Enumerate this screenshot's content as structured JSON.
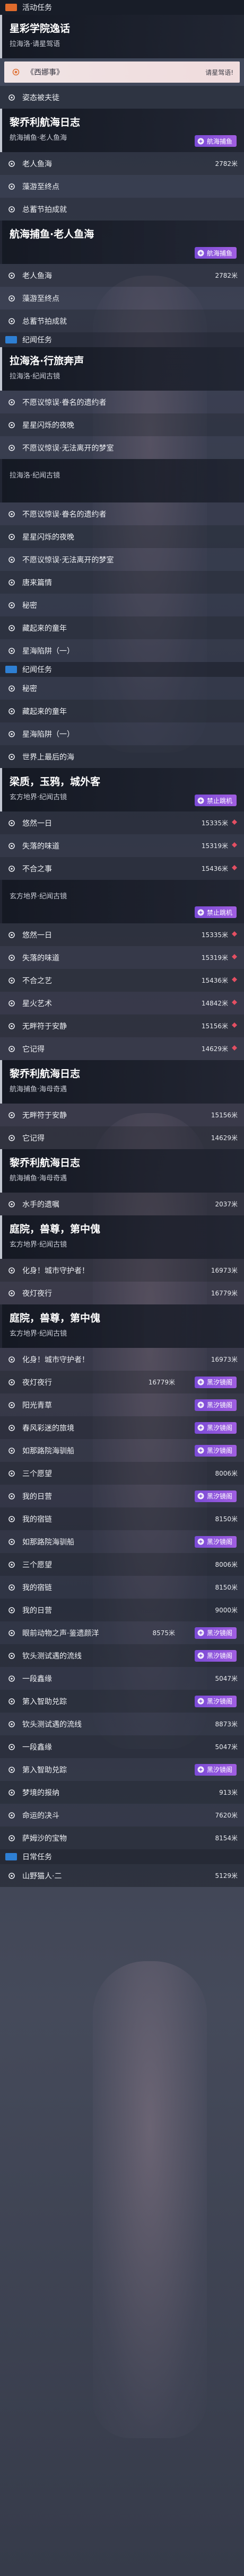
{
  "sections": [
    {
      "type": "cat",
      "active": true,
      "color": "#df6b2c",
      "label": "活动任务"
    },
    {
      "type": "q",
      "title": "星彩学院逸话",
      "sub": "拉海洛·请星驾语"
    },
    {
      "type": "hi",
      "label": "《西娜事》",
      "right": "请星驾语!"
    },
    {
      "type": "row",
      "label": "姿态被夫徒",
      "icon": "circle",
      "dist": "",
      "diamond": false
    },
    {
      "type": "q",
      "title": "黎乔利航海日志",
      "sub": "航海捕鱼·老人鱼海",
      "tag": "航海捕鱼"
    },
    {
      "type": "row",
      "label": "老人鱼海",
      "icon": "circle",
      "dist": "2782米",
      "diamond": false
    },
    {
      "type": "row",
      "label": "藻游至终点",
      "icon": "circle",
      "dist": "",
      "diamond": false
    },
    {
      "type": "row",
      "label": "总蓄节拍成就",
      "icon": "circle",
      "dist": "",
      "diamond": false
    },
    {
      "type": "q",
      "title": "航海捕鱼·老人鱼海",
      "sub": "",
      "tag": "航海捕鱼",
      "plain": true
    },
    {
      "type": "row",
      "label": "老人鱼海",
      "icon": "circle",
      "dist": "2782米",
      "diamond": false
    },
    {
      "type": "row",
      "label": "藻游至终点",
      "icon": "circle",
      "dist": "",
      "diamond": false
    },
    {
      "type": "row",
      "label": "总蓄节拍成就",
      "icon": "circle",
      "dist": "",
      "diamond": false
    },
    {
      "type": "cat",
      "active": false,
      "color": "#2e7fd3",
      "label": "纪闻任务"
    },
    {
      "type": "q",
      "title": "拉海洛·行旅奔声",
      "sub": "拉海洛·纪闻古镜"
    },
    {
      "type": "row",
      "label": "不愿议惊误·眷名的遗约者",
      "icon": "circle",
      "dist": "",
      "diamond": false
    },
    {
      "type": "row",
      "label": "星星闪烁的夜晚",
      "icon": "circle",
      "dist": "",
      "diamond": false
    },
    {
      "type": "row",
      "label": "不愿议惊误·无法离开的梦室",
      "icon": "circle",
      "dist": "",
      "diamond": false
    },
    {
      "type": "q",
      "title": "",
      "sub": "拉海洛·纪闻古镜",
      "plain": true
    },
    {
      "type": "row",
      "label": "不愿议惊误·眷名的遗约者",
      "icon": "circle",
      "dist": "",
      "diamond": false
    },
    {
      "type": "row",
      "label": "星星闪烁的夜晚",
      "icon": "circle",
      "dist": "",
      "diamond": false
    },
    {
      "type": "row",
      "label": "不愿议惊误·无法离开的梦室",
      "icon": "circle",
      "dist": "",
      "diamond": false
    },
    {
      "type": "row",
      "label": "唐来篇情",
      "icon": "circle",
      "dist": "",
      "diamond": false
    },
    {
      "type": "row",
      "label": "秘密",
      "icon": "circle",
      "dist": "",
      "diamond": false
    },
    {
      "type": "row",
      "label": "藏起来的童年",
      "icon": "circle",
      "dist": "",
      "diamond": false
    },
    {
      "type": "row",
      "label": "星海陷阱（一）",
      "icon": "circle",
      "dist": "",
      "diamond": false
    },
    {
      "type": "cat",
      "active": false,
      "color": "#2e7fd3",
      "label": "纪闻任务"
    },
    {
      "type": "row",
      "label": "秘密",
      "icon": "circle",
      "dist": "",
      "diamond": false
    },
    {
      "type": "row",
      "label": "藏起来的童年",
      "icon": "circle",
      "dist": "",
      "diamond": false
    },
    {
      "type": "row",
      "label": "星海陷阱（一）",
      "icon": "circle",
      "dist": "",
      "diamond": false
    },
    {
      "type": "row",
      "label": "世界上最后的海",
      "icon": "circle",
      "dist": "",
      "diamond": false
    },
    {
      "type": "q",
      "title": "梁质，玉鸦，城外客",
      "sub": "玄方地界·纪闻古镜",
      "tag": "禁止跳机"
    },
    {
      "type": "row",
      "label": "悠然一日",
      "icon": "circle",
      "dist": "15335米",
      "diamond": true
    },
    {
      "type": "row",
      "label": "失落的味道",
      "icon": "circle",
      "dist": "15319米",
      "diamond": true
    },
    {
      "type": "row",
      "label": "不合之事",
      "icon": "circle",
      "dist": "15436米",
      "diamond": true
    },
    {
      "type": "q",
      "title": "",
      "sub": "玄方地界·纪闻古镜",
      "tag": "禁止跳机",
      "plain": true
    },
    {
      "type": "row",
      "label": "悠然一日",
      "icon": "circle",
      "dist": "15335米",
      "diamond": true
    },
    {
      "type": "row",
      "label": "失落的味道",
      "icon": "circle",
      "dist": "15319米",
      "diamond": true
    },
    {
      "type": "row",
      "label": "不合之艺",
      "icon": "circle",
      "dist": "15436米",
      "diamond": true
    },
    {
      "type": "row",
      "label": "星火艺术",
      "icon": "circle",
      "dist": "14842米",
      "diamond": true
    },
    {
      "type": "row",
      "label": "无畔符于安静",
      "icon": "circle",
      "dist": "15156米",
      "diamond": true
    },
    {
      "type": "row",
      "label": "它记得",
      "icon": "circle",
      "dist": "14629米",
      "diamond": true
    },
    {
      "type": "q",
      "title": "黎乔利航海日志",
      "sub": "航海捕鱼·海母奇遇"
    },
    {
      "type": "row",
      "label": "无畔符于安静",
      "icon": "circle",
      "dist": "15156米",
      "diamond": false
    },
    {
      "type": "row",
      "label": "它记得",
      "icon": "circle",
      "dist": "14629米",
      "diamond": false
    },
    {
      "type": "q",
      "title": "黎乔利航海日志",
      "sub": "航海捕鱼·海母奇遇"
    },
    {
      "type": "row",
      "label": "水手的遗嘱",
      "icon": "circle",
      "dist": "2037米",
      "diamond": false
    },
    {
      "type": "q",
      "title": "庭院，兽尊，第中傀",
      "sub": "玄方地界·纪闻古镜"
    },
    {
      "type": "row",
      "label": "化身！城市守护者！",
      "icon": "circle",
      "dist": "16973米",
      "diamond": false
    },
    {
      "type": "row",
      "label": "夜灯夜行",
      "icon": "circle",
      "dist": "16779米",
      "diamond": false
    },
    {
      "type": "q",
      "title": "庭院，兽尊，第中傀",
      "sub": "玄方地界·纪闻古镜",
      "plain": true
    },
    {
      "type": "row",
      "label": "化身！城市守护者！",
      "icon": "circle",
      "dist": "16973米",
      "diamond": false
    },
    {
      "type": "row",
      "label": "夜灯夜行",
      "icon": "circle",
      "dist": "16779米",
      "diamond": false,
      "badge": "黑汐镜阁"
    },
    {
      "type": "row",
      "label": "阳光青草",
      "icon": "circle",
      "dist": "",
      "diamond": false,
      "badge": "黑汐镜阁"
    },
    {
      "type": "row",
      "label": "春风彩迷的旅境",
      "icon": "circle",
      "dist": "",
      "diamond": false,
      "badge": "黑汐镜阁"
    },
    {
      "type": "row",
      "label": "如那路院海驯船",
      "icon": "circle",
      "dist": "",
      "diamond": false,
      "badge": "黑汐镜阁"
    },
    {
      "type": "row",
      "label": "三个愿望",
      "icon": "circle",
      "dist": "8006米",
      "diamond": false
    },
    {
      "type": "row",
      "label": "我的日营",
      "icon": "circle",
      "dist": "",
      "diamond": false,
      "badge": "黑汐镜阁"
    },
    {
      "type": "row",
      "label": "我的宿链",
      "icon": "circle",
      "dist": "8150米",
      "diamond": false
    },
    {
      "type": "row",
      "label": "如那路院海驯船",
      "icon": "circle",
      "dist": "",
      "diamond": false,
      "badge": "黑汐镜阁"
    },
    {
      "type": "row",
      "label": "三个愿望",
      "icon": "circle",
      "dist": "8006米",
      "diamond": false
    },
    {
      "type": "row",
      "label": "我的宿链",
      "icon": "circle",
      "dist": "8150米",
      "diamond": false
    },
    {
      "type": "row",
      "label": "我的日营",
      "icon": "circle",
      "dist": "9000米",
      "diamond": false
    },
    {
      "type": "row",
      "label": "眼前动物之声·鉴遗颜洋",
      "icon": "circle",
      "dist": "8575米",
      "diamond": false,
      "badge": "黑汐镜阁"
    },
    {
      "type": "row",
      "label": "钦头测试遇的流线",
      "icon": "circle",
      "dist": "",
      "diamond": false,
      "badge": "黑汐镜阁"
    },
    {
      "type": "row",
      "label": "一段鑫缘",
      "icon": "circle",
      "dist": "5047米",
      "diamond": false
    },
    {
      "type": "row",
      "label": "第入智助兑踪",
      "icon": "circle",
      "dist": "",
      "diamond": false,
      "badge": "黑汐镜阁"
    },
    {
      "type": "row",
      "label": "钦头测试遇的流线",
      "icon": "circle",
      "dist": "8873米",
      "diamond": false
    },
    {
      "type": "row",
      "label": "一段鑫缘",
      "icon": "circle",
      "dist": "5047米",
      "diamond": false
    },
    {
      "type": "row",
      "label": "第入智助兑踪",
      "icon": "circle",
      "dist": "",
      "diamond": false,
      "badge": "黑汐镜阁"
    },
    {
      "type": "row",
      "label": "梦境的报纳",
      "icon": "circle",
      "dist": "913米",
      "diamond": false
    },
    {
      "type": "row",
      "label": "命运的决斗",
      "icon": "circle",
      "dist": "7620米",
      "diamond": false
    },
    {
      "type": "row",
      "label": "萨姆沙的宝物",
      "icon": "circle",
      "dist": "8154米",
      "diamond": false
    },
    {
      "type": "cat",
      "active": false,
      "color": "#2e7fd3",
      "label": "日常任务"
    },
    {
      "type": "row",
      "label": "山野猫人·二",
      "icon": "circle",
      "dist": "5129米",
      "diamond": false
    }
  ]
}
